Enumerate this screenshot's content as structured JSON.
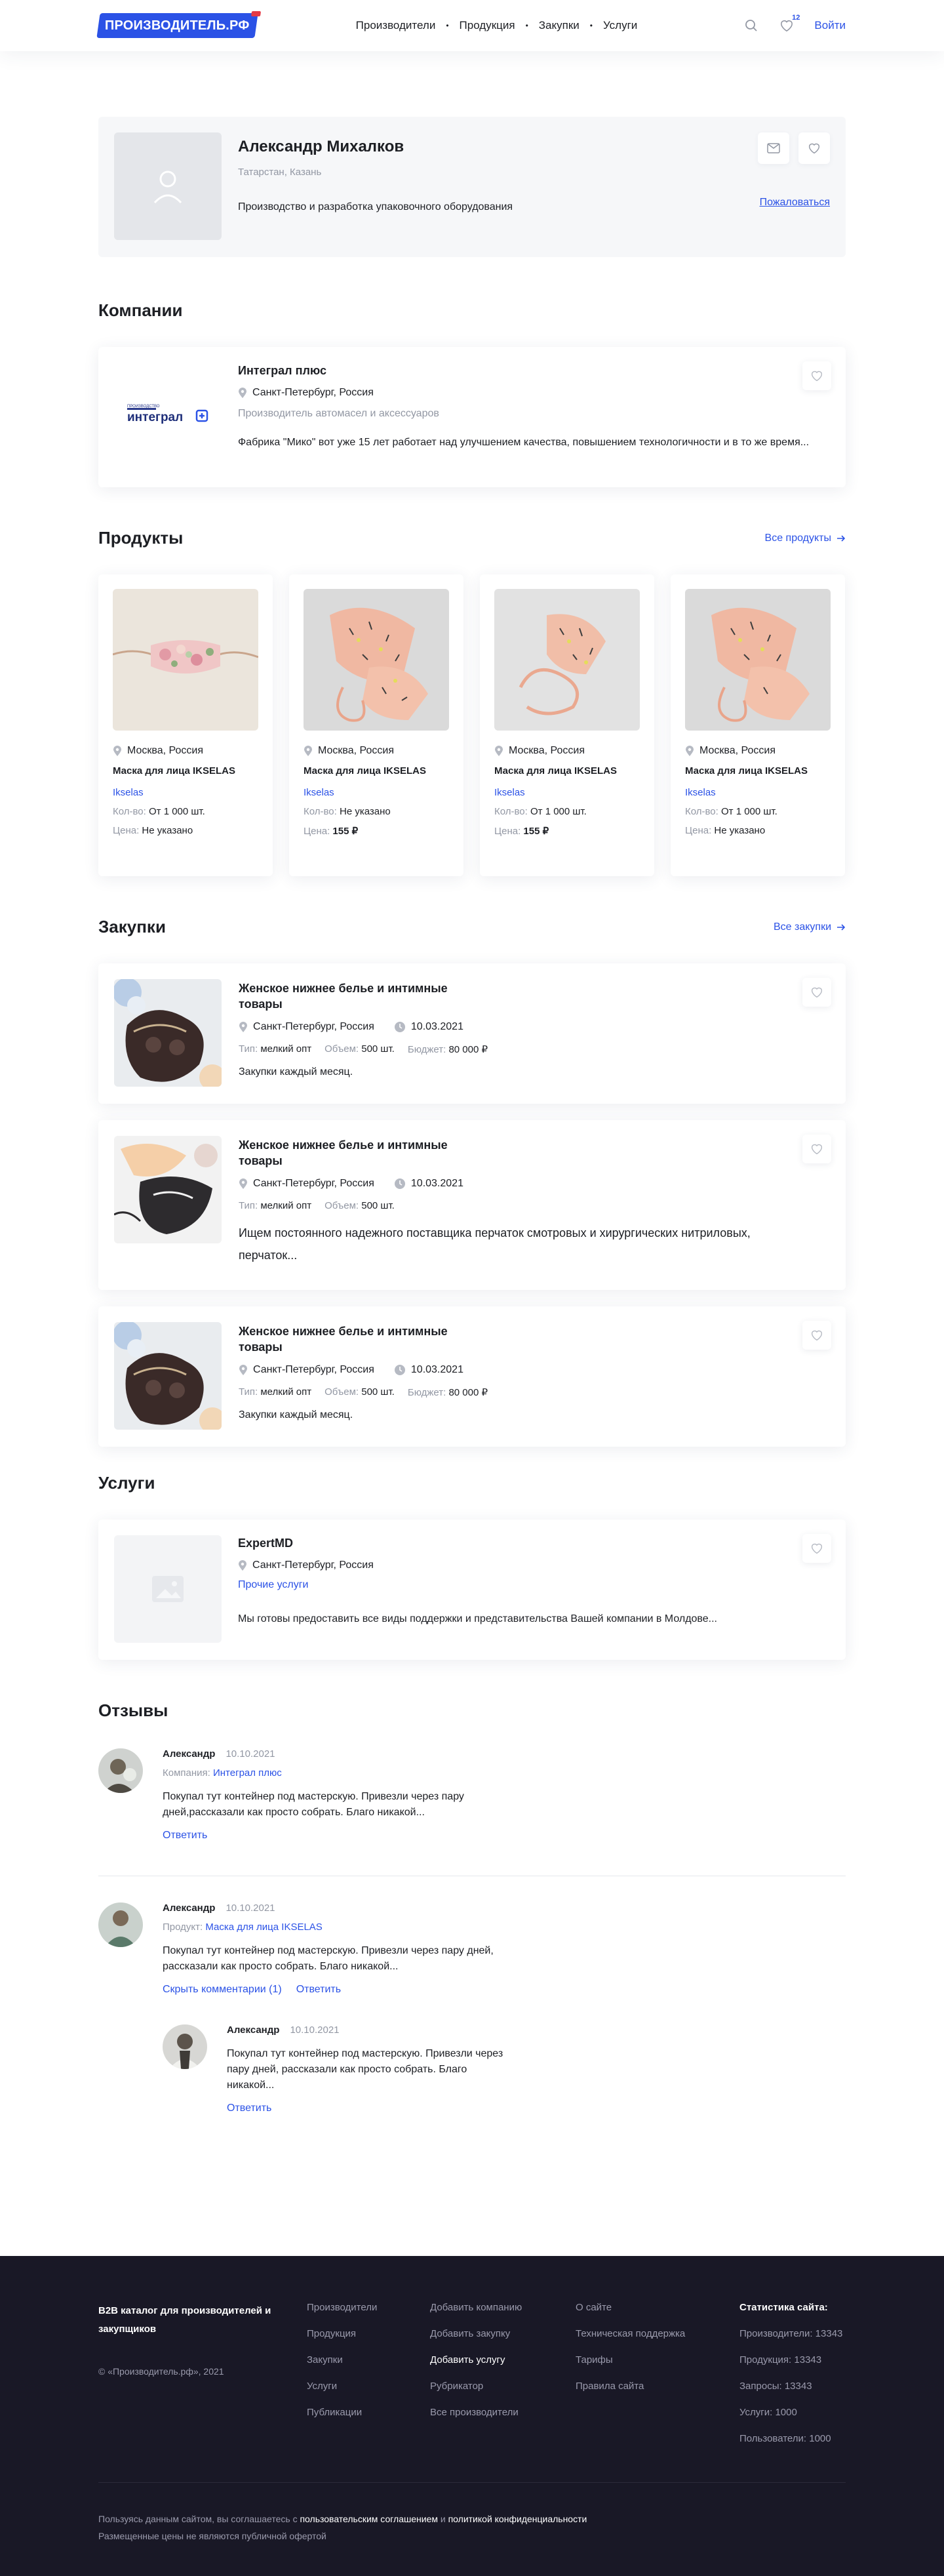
{
  "header": {
    "logo": "ПРОИЗВОДИТЕЛЬ.РФ",
    "nav": [
      "Производители",
      "Продукция",
      "Закупки",
      "Услуги"
    ],
    "favorites_count": "12",
    "login": "Войти"
  },
  "profile": {
    "name": "Александр Михалков",
    "location": "Татарстан, Казань",
    "description": "Производство и разработка упаковочного оборудования",
    "complain": "Пожаловаться"
  },
  "companies": {
    "title": "Компании",
    "items": [
      {
        "name": "Интеграл плюс",
        "location": "Санкт-Петербург, Россия",
        "category": "Производитель автомасел и аксессуаров",
        "description": "Фабрика \"Мико\" вот уже 15 лет работает над улучшением качества, повышением технологичности и в то же время...",
        "logo_small": "ПРОИЗВОДСТВО",
        "logo_text": "интеграл"
      }
    ]
  },
  "products": {
    "title": "Продукты",
    "all_link": "Все продукты",
    "qty_label": "Кол-во:",
    "price_label": "Цена:",
    "items": [
      {
        "location": "Москва, Россия",
        "name": "Маска для лица IKSELAS",
        "brand": "Ikselas",
        "qty": "От 1 000 шт.",
        "price": "Не указано"
      },
      {
        "location": "Москва, Россия",
        "name": "Маска для лица IKSELAS",
        "brand": "Ikselas",
        "qty": "Не указано",
        "price": "155 ₽"
      },
      {
        "location": "Москва, Россия",
        "name": "Маска для лица IKSELAS",
        "brand": "Ikselas",
        "qty": "От 1 000 шт.",
        "price": "155 ₽"
      },
      {
        "location": "Москва, Россия",
        "name": "Маска для лица IKSELAS",
        "brand": "Ikselas",
        "qty": "От 1 000 шт.",
        "price": "Не указано"
      }
    ]
  },
  "purchases": {
    "title": "Закупки",
    "all_link": "Все закупки",
    "type_label": "Тип:",
    "volume_label": "Объем:",
    "budget_label": "Бюджет:",
    "items": [
      {
        "name": "Женское нижнее белье и интимные товары",
        "location": "Санкт-Петербург, Россия",
        "date": "10.03.2021",
        "type": "мелкий опт",
        "volume": "500 шт.",
        "budget": "80 000 ₽",
        "description": "Закупки каждый месяц."
      },
      {
        "name": "Женское нижнее белье и интимные товары",
        "location": "Санкт-Петербург, Россия",
        "date": "10.03.2021",
        "type": "мелкий опт",
        "volume": "500 шт.",
        "budget": "",
        "description": "Ищем постоянного надежного поставщика перчаток смотровых и хирургических нитриловых, перчаток..."
      },
      {
        "name": "Женское нижнее белье и интимные товары",
        "location": "Санкт-Петербург, Россия",
        "date": "10.03.2021",
        "type": "мелкий опт",
        "volume": "500 шт.",
        "budget": "80 000 ₽",
        "description": "Закупки каждый месяц."
      }
    ]
  },
  "services": {
    "title": "Услуги",
    "items": [
      {
        "name": "ExpertMD",
        "location": "Санкт-Петербург, Россия",
        "category": "Прочие услуги",
        "description": "Мы готовы предоставить все виды поддержки и представительства Вашей компании в Молдове..."
      }
    ]
  },
  "reviews": {
    "title": "Отзывы",
    "items": [
      {
        "author": "Александр",
        "date": "10.10.2021",
        "ref_label": "Компания:",
        "ref_value": "Интеграл плюс",
        "text": "Покупал тут контейнер под мастерскую. Привезли  через пару дней,рассказали  как просто собрать. Благо никакой...",
        "reply": "Ответить"
      },
      {
        "author": "Александр",
        "date": "10.10.2021",
        "ref_label": "Продукт:",
        "ref_value": "Маска для лица IKSELAS",
        "text": "Покупал тут контейнер под мастерскую. Привезли через пару дней, рассказали  как просто собрать. Благо никакой...",
        "hide_comments": "Скрыть комментарии (1)",
        "reply": "Ответить"
      }
    ],
    "reply_item": {
      "author": "Александр",
      "date": "10.10.2021",
      "text": "Покупал тут контейнер под мастерскую. Привезли через пару дней, рассказали как просто собрать. Благо никакой...",
      "reply": "Ответить"
    }
  },
  "footer": {
    "tagline": "B2B каталог для производителей и закупщиков",
    "copyright": "© «Производитель.рф», 2021",
    "col1": [
      "Производители",
      "Продукция",
      "Закупки",
      "Услуги",
      "Публикации"
    ],
    "col2": [
      "Добавить компанию",
      "Добавить закупку",
      "Добавить услугу",
      "Рубрикатор",
      "Все производители"
    ],
    "col3": [
      "О сайте",
      "Техническая поддержка",
      "Тарифы",
      "Правила сайта"
    ],
    "stats_title": "Статистика сайта:",
    "stats": [
      "Производители: 13343",
      "Продукция: 13343",
      "Запросы: 13343",
      "Услуги: 1000",
      "Пользователи: 1000"
    ],
    "legal_prefix": "Пользуясь данным сайтом, вы соглашаетесь с",
    "legal_agreement": "пользовательским соглашением",
    "legal_and": "и",
    "legal_privacy": "политикой конфиденциальности",
    "legal_offer": "Размещенные цены не являются публичной офертой"
  },
  "colors": {
    "accent": "#2b52e6",
    "footer_bg": "#191826",
    "muted": "#9297a3"
  }
}
